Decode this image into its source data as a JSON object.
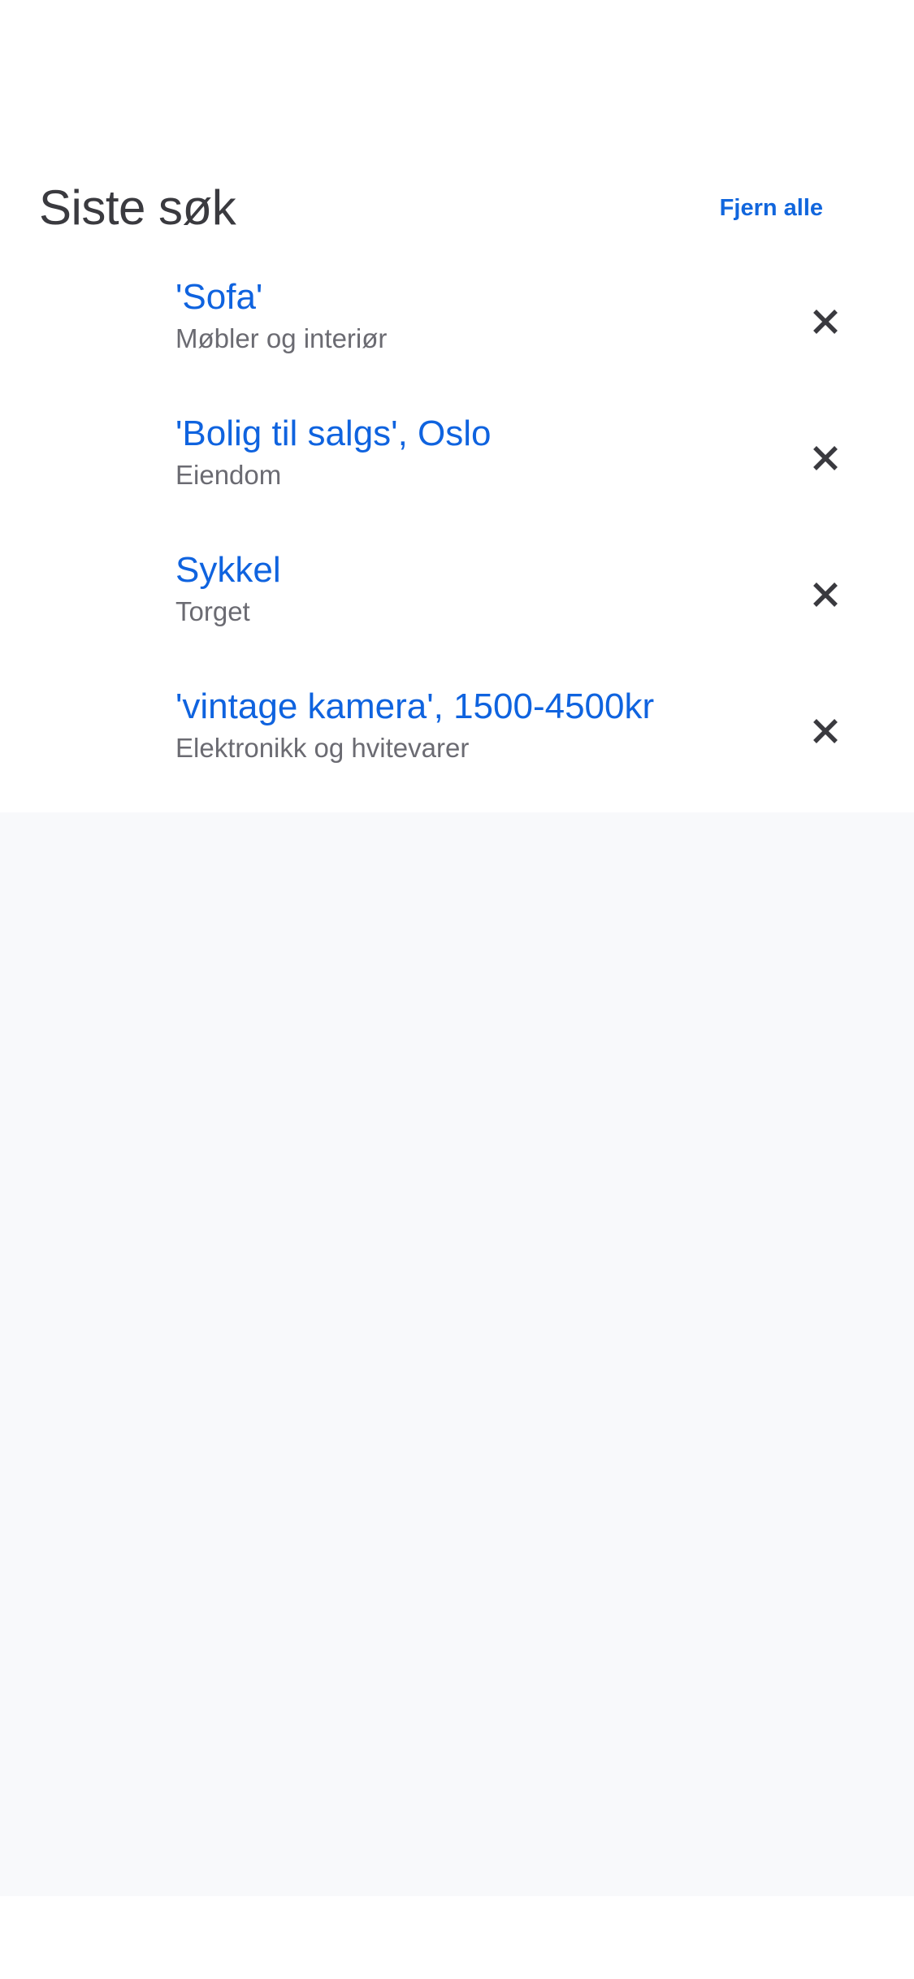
{
  "header": {
    "title": "Siste søk",
    "clear_all_label": "Fjern alle"
  },
  "recent_searches": [
    {
      "query": "'Sofa'",
      "category": "Møbler og interiør",
      "remove_icon": "close-icon"
    },
    {
      "query": "'Bolig til salgs', Oslo",
      "category": "Eiendom",
      "remove_icon": "close-icon"
    },
    {
      "query": "Sykkel",
      "category": "Torget",
      "remove_icon": "close-icon"
    },
    {
      "query": "'vintage kamera', 1500-4500kr",
      "category": "Elektronikk og hvitevarer",
      "remove_icon": "close-icon"
    }
  ],
  "colors": {
    "accent": "#1166dd",
    "title": "#3a3a3f",
    "subtitle": "#6b6b72",
    "icon": "#3a3a3f",
    "background_lower": "#f8f9fb"
  }
}
